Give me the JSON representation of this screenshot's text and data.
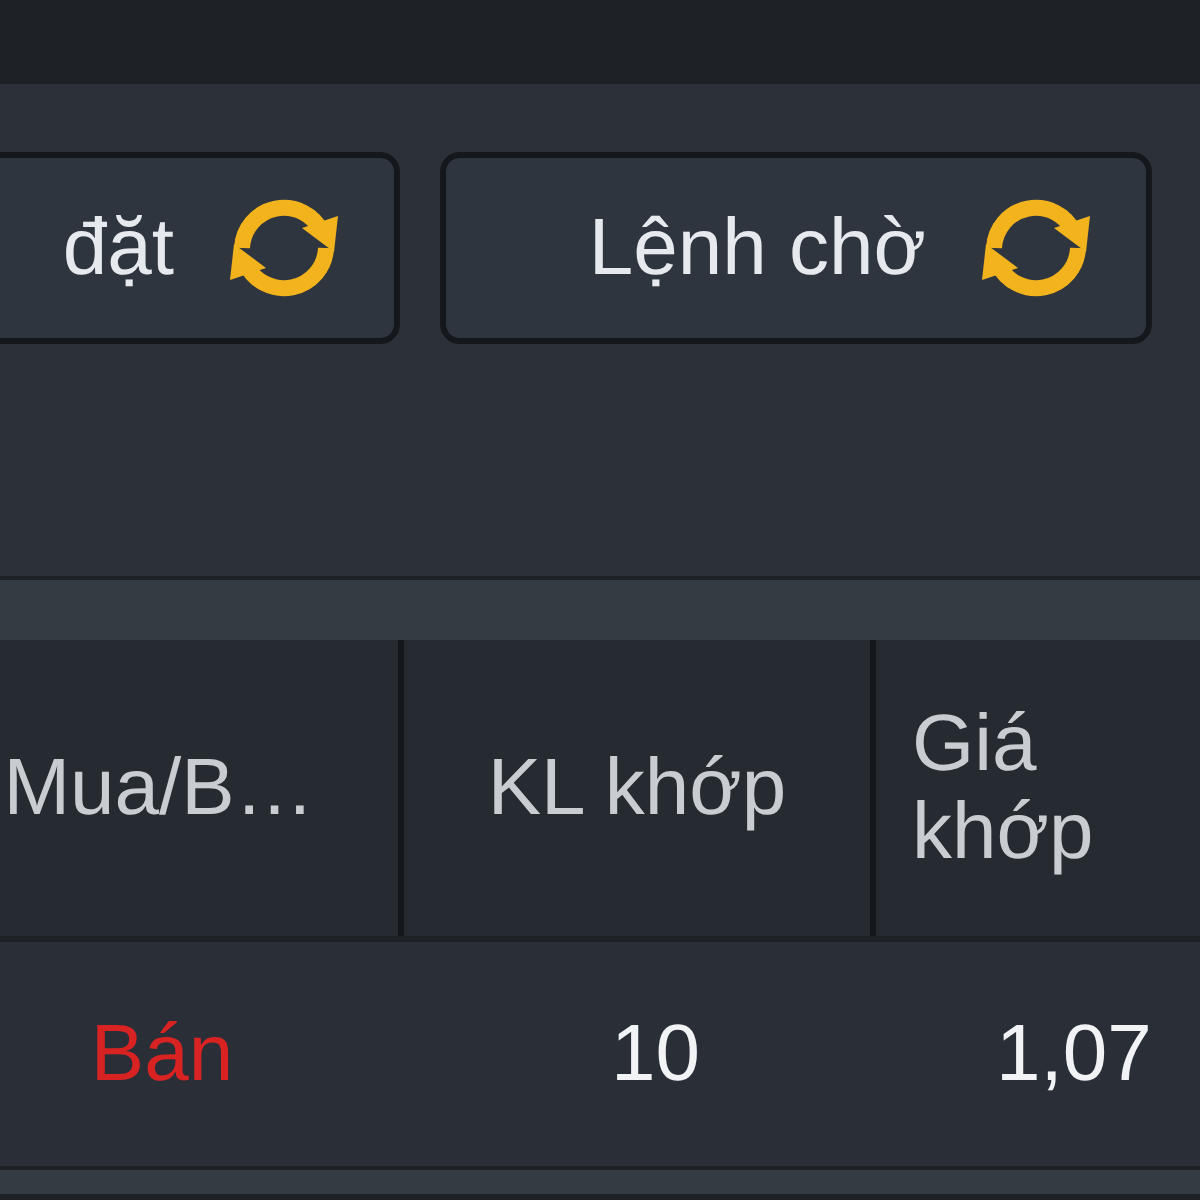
{
  "toolbar": {
    "buttons": [
      {
        "label": "đặt",
        "kind": "refresh"
      },
      {
        "label": "Lệnh chờ",
        "kind": "refresh"
      }
    ]
  },
  "table": {
    "columns": [
      "Mua/B…",
      "KL khớp",
      "Giá khớp"
    ],
    "rows": [
      {
        "cells": [
          {
            "text": "Bán",
            "kind": "sell"
          },
          {
            "text": "10",
            "kind": "number"
          },
          {
            "text": "1,07",
            "kind": "number"
          }
        ]
      }
    ]
  }
}
